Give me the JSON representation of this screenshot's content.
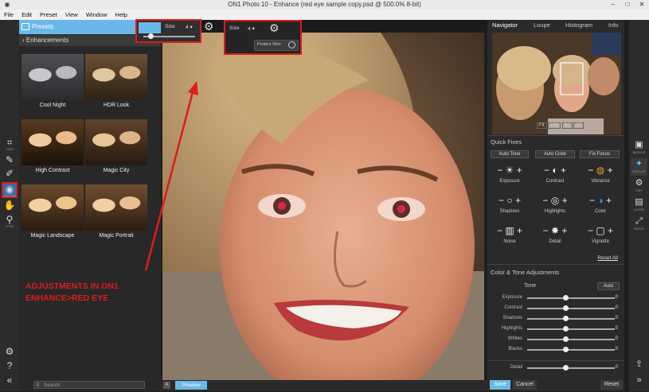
{
  "window": {
    "title": "ON1 Photo 10 - Enhance (red eye sample copy.psd @ 500.0% 8-bit)"
  },
  "menu": [
    "File",
    "Edit",
    "Preset",
    "View",
    "Window",
    "Help"
  ],
  "tools": [
    {
      "icon": "crop-icon",
      "glyph": "⌗",
      "label": "CROP"
    },
    {
      "icon": "retouch-brush-icon",
      "glyph": "✎",
      "label": ""
    },
    {
      "icon": "adjustment-brush-icon",
      "glyph": "✐",
      "label": ""
    },
    {
      "icon": "red-eye-icon",
      "glyph": "◉",
      "label": "RED EYE"
    },
    {
      "icon": "hand-icon",
      "glyph": "✋",
      "label": ""
    },
    {
      "icon": "zoom-icon",
      "glyph": "⚲",
      "label": "ZOOM"
    }
  ],
  "left_panel": {
    "header": "Presets",
    "subheader": "Enhancements",
    "presets": [
      "Cool Night",
      "HDR Look",
      "High Contrast",
      "Magic City",
      "Magic Landscape",
      "Magic Portrait"
    ],
    "search_placeholder": "Search"
  },
  "options_bar": {
    "size_label": "Size",
    "size_value": "4",
    "protect_skin_label": "Protect Skin"
  },
  "annotation": {
    "line1": "ADJUSTMENTS IN ON1",
    "line2": "ENHANCE>RED EYE"
  },
  "bottom": {
    "preview_label": "Preview"
  },
  "right_panel": {
    "tabs": [
      "Navigator",
      "Loupe",
      "Histogram",
      "Info"
    ],
    "zoom_buttons": [
      "Fit",
      "100",
      "50",
      "25"
    ],
    "quick_fixes_title": "Quick Fixes",
    "quick_fix_buttons": [
      "Auto Tone",
      "Auto Color",
      "Fix Focus"
    ],
    "quick_fixes": [
      {
        "label": "Exposure",
        "glyph": "☀"
      },
      {
        "label": "Contrast",
        "glyph": "◐"
      },
      {
        "label": "Vibrance",
        "glyph": "◍"
      },
      {
        "label": "Shadows",
        "glyph": "○"
      },
      {
        "label": "Highlights",
        "glyph": "◎"
      },
      {
        "label": "Color",
        "glyph": "◑"
      },
      {
        "label": "Noise",
        "glyph": "▥"
      },
      {
        "label": "Detail",
        "glyph": "✸"
      },
      {
        "label": "Vignette",
        "glyph": "▢"
      }
    ],
    "reset_all": "Reset All",
    "color_tone_title": "Color & Tone Adjustments",
    "tone_label": "Tone",
    "auto_label": "Auto",
    "sliders": [
      {
        "name": "Exposure",
        "value": "0"
      },
      {
        "name": "Contrast",
        "value": "0"
      },
      {
        "name": "Shadows",
        "value": "0"
      },
      {
        "name": "Highlights",
        "value": "0"
      },
      {
        "name": "Whites",
        "value": "0"
      },
      {
        "name": "Blacks",
        "value": "0"
      }
    ],
    "detail_slider": {
      "name": "Detail",
      "value": "0"
    },
    "save_label": "Save",
    "cancel_label": "Cancel",
    "reset_label": "Reset"
  },
  "modules": [
    {
      "icon": "browse-icon",
      "label": "BROWSE"
    },
    {
      "icon": "develop-icon",
      "label": "DEVELOP"
    },
    {
      "icon": "effects-icon",
      "label": "EDIT"
    },
    {
      "icon": "layers-icon",
      "label": "LAYERS"
    },
    {
      "icon": "resize-icon",
      "label": "RESIZE"
    }
  ]
}
